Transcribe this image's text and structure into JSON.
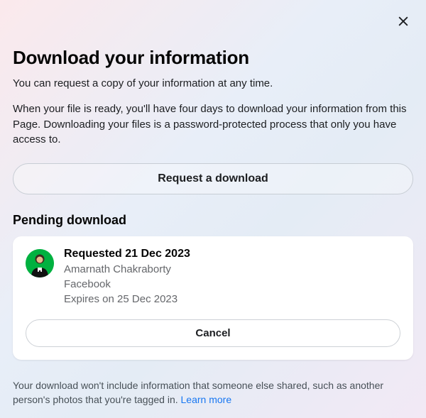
{
  "title": "Download your information",
  "intro": "You can request a copy of your information at any time.",
  "body": "When your file is ready, you'll have four days to download your information from this Page. Downloading your files is a password-protected process that only you have access to.",
  "request_button": "Request a download",
  "pending": {
    "heading": "Pending download",
    "card": {
      "requested_label": "Requested 21 Dec 2023",
      "user_name": "Amarnath Chakraborty",
      "platform": "Facebook",
      "expires": "Expires on 25 Dec 2023",
      "cancel_label": "Cancel"
    }
  },
  "footer": {
    "text": "Your download won't include information that someone else shared, such as another person's photos that you're tagged in. ",
    "link": "Learn more"
  }
}
